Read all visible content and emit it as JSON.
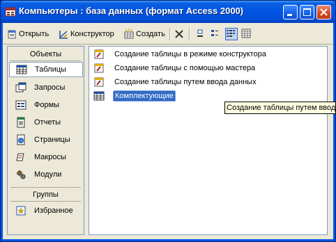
{
  "window": {
    "title": "Компьютеры : база данных (формат Access 2000)"
  },
  "toolbar": {
    "open_label": "Открыть",
    "design_label": "Конструктор",
    "create_label": "Создать"
  },
  "objects_pane": {
    "objects_header": "Объекты",
    "items": [
      {
        "label": "Таблицы",
        "icon": "table-icon",
        "selected": true
      },
      {
        "label": "Запросы",
        "icon": "query-icon"
      },
      {
        "label": "Формы",
        "icon": "form-icon"
      },
      {
        "label": "Отчеты",
        "icon": "report-icon"
      },
      {
        "label": "Страницы",
        "icon": "page-icon"
      },
      {
        "label": "Макросы",
        "icon": "macro-icon"
      },
      {
        "label": "Модули",
        "icon": "module-icon"
      }
    ],
    "groups_header": "Группы",
    "groups": [
      {
        "label": "Избранное",
        "icon": "favorites-icon"
      }
    ]
  },
  "list": {
    "items": [
      {
        "label": "Создание таблицы в режиме конструктора",
        "icon": "create-shortcut-icon"
      },
      {
        "label": "Создание таблицы с помощью мастера",
        "icon": "create-shortcut-icon"
      },
      {
        "label": "Создание таблицы путем ввода данных",
        "icon": "create-shortcut-icon"
      },
      {
        "label": "Комплектующие",
        "icon": "table-icon",
        "selected": true
      }
    ]
  },
  "tooltip": {
    "text": "Создание таблицы путем ввода данных"
  },
  "colors": {
    "titlebar": "#0054e3",
    "selection": "#316ac5",
    "pane_border": "#7f9db9"
  }
}
